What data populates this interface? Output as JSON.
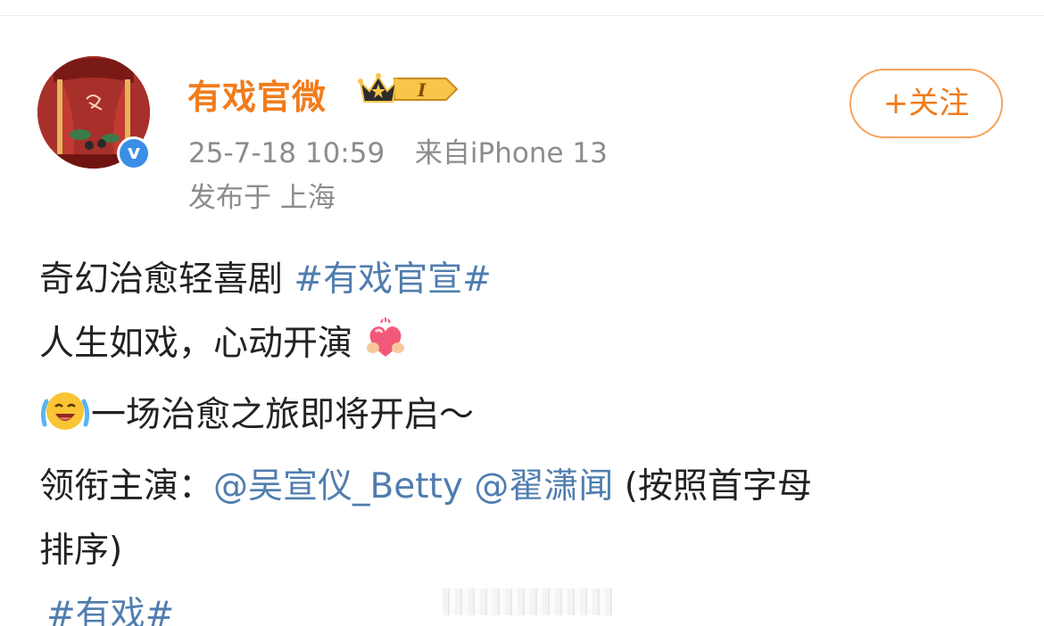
{
  "user": {
    "name": "有戏官微",
    "vip_level": "I",
    "verified_mark": "v"
  },
  "post_meta": {
    "timestamp": "25-7-18 10:59",
    "source": "来自iPhone 13",
    "location": "发布于 上海"
  },
  "follow_button": {
    "label": "+关注"
  },
  "post": {
    "line1_text": "奇幻治愈轻喜剧 ",
    "line1_topic": "#有戏官宣#",
    "line2_text": "人生如戏，心动开演",
    "line2_emoji": "heart-hug-emoji",
    "line3_emoji": "happy-cry-emoji",
    "line3_text": "一场治愈之旅即将开启～",
    "line4_prefix": "领衔主演：",
    "mention_1": "@吴宣仪_Betty",
    "mention_2": "@翟潇闻",
    "line4_suffix": " (按照首字母",
    "line5_text": "排序)",
    "bottom_topic": "#有戏#"
  },
  "colors": {
    "username": "#f07c1c",
    "link": "#507daf",
    "meta": "#8c8c8c",
    "body": "#222222",
    "follow_border": "#f7a35c",
    "verified": "#3a8ee6"
  },
  "icons": {
    "crown": "crown-icon",
    "verified": "verified-badge-icon"
  }
}
